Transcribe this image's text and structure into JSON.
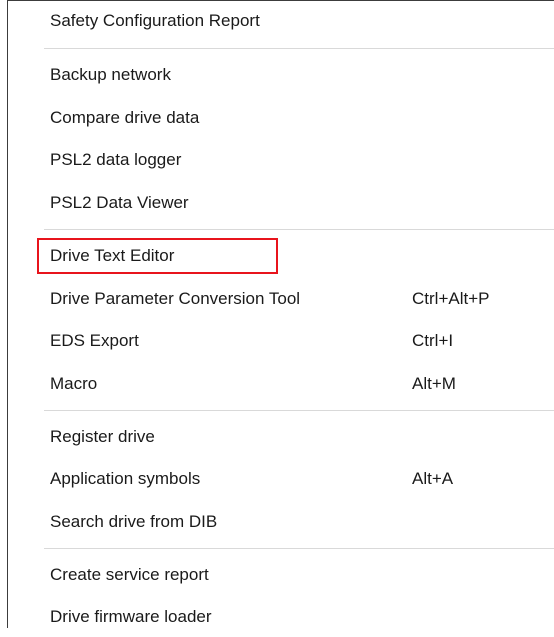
{
  "menu": {
    "items": [
      {
        "label": "Safety Configuration Report",
        "shortcut": ""
      },
      {
        "label": "Backup network",
        "shortcut": ""
      },
      {
        "label": "Compare drive data",
        "shortcut": ""
      },
      {
        "label": "PSL2 data logger",
        "shortcut": ""
      },
      {
        "label": "PSL2 Data Viewer",
        "shortcut": ""
      },
      {
        "label": "Drive Text Editor",
        "shortcut": ""
      },
      {
        "label": "Drive Parameter Conversion Tool",
        "shortcut": "Ctrl+Alt+P"
      },
      {
        "label": "EDS Export",
        "shortcut": "Ctrl+I"
      },
      {
        "label": "Macro",
        "shortcut": "Alt+M"
      },
      {
        "label": "Register drive",
        "shortcut": ""
      },
      {
        "label": "Application symbols",
        "shortcut": "Alt+A"
      },
      {
        "label": "Search drive from DIB",
        "shortcut": ""
      },
      {
        "label": "Create service report",
        "shortcut": ""
      },
      {
        "label": "Drive firmware loader",
        "shortcut": ""
      }
    ]
  },
  "colors": {
    "highlight_border": "#e8141c",
    "separator": "#d9d9d9",
    "text": "#1a1a1a"
  }
}
